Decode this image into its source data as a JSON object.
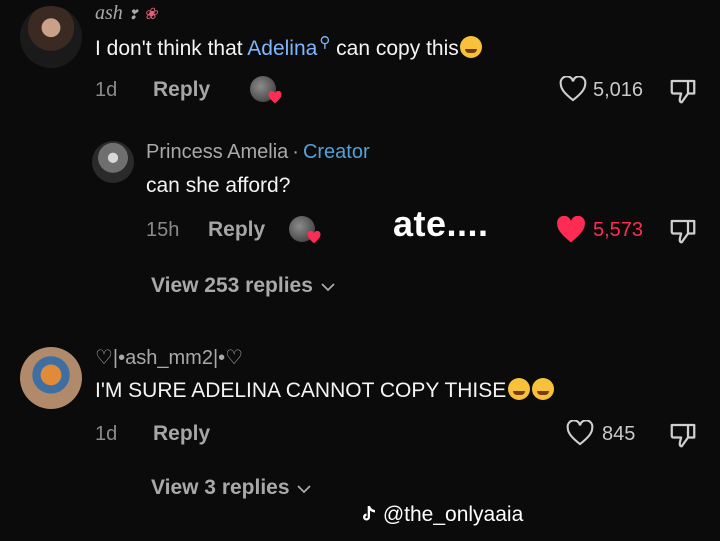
{
  "comments": [
    {
      "username": "ash",
      "text_before": "I don't think that ",
      "mention": "Adelina",
      "text_after": " can copy this",
      "time": "1d",
      "reply_label": "Reply",
      "likes": "5,016"
    },
    {
      "username": "Princess Amelia",
      "separator": "·",
      "badge": "Creator",
      "text": "can she afford?",
      "time": "15h",
      "reply_label": "Reply",
      "likes": "5,573"
    },
    {
      "username": "♡|•ash_mm2|•♡",
      "text": "I'M SURE ADELINA CANNOT COPY THISE",
      "time": "1d",
      "reply_label": "Reply",
      "likes": "845"
    }
  ],
  "view_replies_1": "View 253 replies",
  "view_replies_2": "View 3 replies",
  "overlay_caption": "ate....",
  "watermark": "@the_onlyaaia",
  "colors": {
    "liked_heart": "#fe2c55",
    "mention": "#7fb7ff",
    "creator": "#4fa3d6"
  }
}
